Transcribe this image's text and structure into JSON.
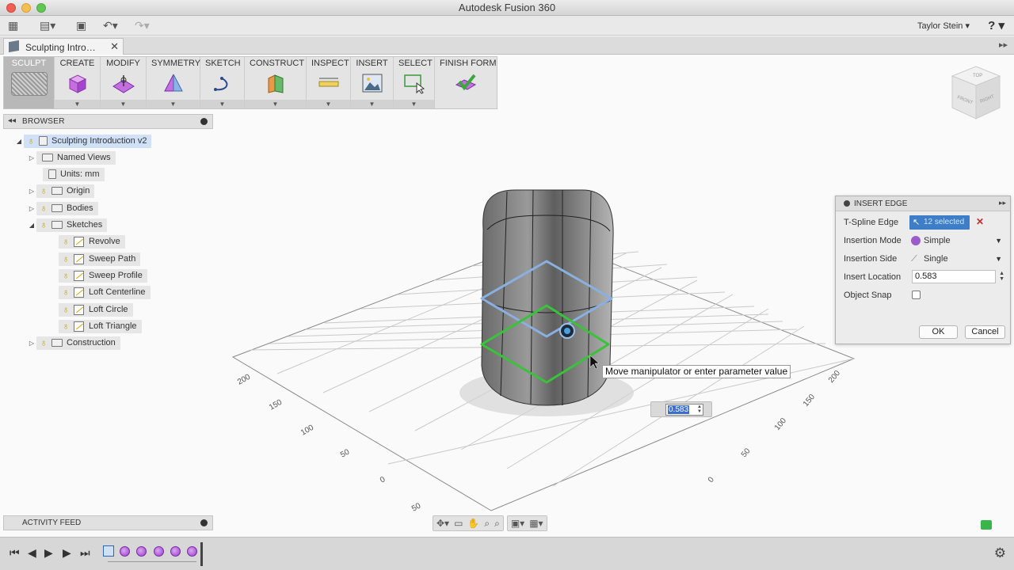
{
  "window": {
    "title": "Autodesk Fusion 360"
  },
  "quick_access": {
    "user": "Taylor Stein",
    "help": "?"
  },
  "document_tab": {
    "name": "Sculpting Intro…"
  },
  "ribbon": {
    "groups": [
      {
        "label": "SCULPT"
      },
      {
        "label": "CREATE"
      },
      {
        "label": "MODIFY"
      },
      {
        "label": "SYMMETRY"
      },
      {
        "label": "SKETCH"
      },
      {
        "label": "CONSTRUCT"
      },
      {
        "label": "INSPECT"
      },
      {
        "label": "INSERT"
      },
      {
        "label": "SELECT"
      },
      {
        "label": "FINISH FORM"
      }
    ]
  },
  "browser": {
    "title": "BROWSER",
    "root": "Sculpting Introduction v2",
    "named_views": "Named Views",
    "units": "Units: mm",
    "origin": "Origin",
    "bodies": "Bodies",
    "sketches": "Sketches",
    "sketch_items": [
      "Revolve",
      "Sweep Path",
      "Sweep Profile",
      "Loft Centerline",
      "Loft Circle",
      "Loft Triangle"
    ],
    "construction": "Construction"
  },
  "activity_feed": {
    "title": "ACTIVITY FEED"
  },
  "viewcube": {
    "top": "TOP",
    "front": "FRONT",
    "right": "RIGHT"
  },
  "insert_edge": {
    "title": "INSERT EDGE",
    "tspline_edge_label": "T-Spline Edge",
    "tspline_edge_value": "12 selected",
    "insertion_mode_label": "Insertion Mode",
    "insertion_mode_value": "Simple",
    "insertion_side_label": "Insertion Side",
    "insertion_side_value": "Single",
    "insert_location_label": "Insert Location",
    "insert_location_value": "0.583",
    "object_snap_label": "Object Snap",
    "ok": "OK",
    "cancel": "Cancel"
  },
  "canvas": {
    "tooltip": "Move manipulator or enter parameter value",
    "value_input": "0.583",
    "grid_labels_left": [
      "200",
      "150",
      "100",
      "50",
      "0",
      "50"
    ],
    "grid_labels_right": [
      "200",
      "150",
      "100",
      "50",
      "0"
    ]
  },
  "colors": {
    "selected_edge": "#8ab0e0",
    "manipulator_edge": "#39c23a",
    "accent": "#3d7ec7"
  }
}
